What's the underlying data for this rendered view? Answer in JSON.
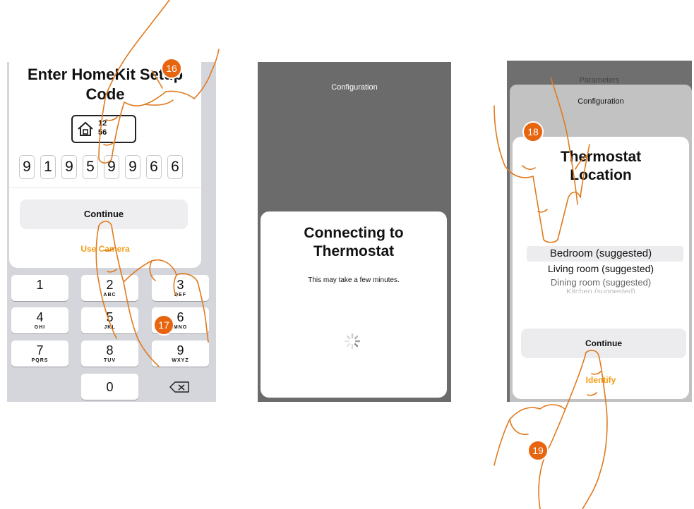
{
  "screen1": {
    "title": "Enter HomeKit Setup Code",
    "code_label_line1": "12",
    "code_label_line2": "56",
    "digits": [
      "9",
      "1",
      "9",
      "5",
      "9",
      "9",
      "6",
      "6"
    ],
    "continue_label": "Continue",
    "use_camera_label": "Use Camera",
    "keypad": [
      {
        "num": "1",
        "letters": ""
      },
      {
        "num": "2",
        "letters": "ABC"
      },
      {
        "num": "3",
        "letters": "DEF"
      },
      {
        "num": "4",
        "letters": "GHI"
      },
      {
        "num": "5",
        "letters": "JKL"
      },
      {
        "num": "6",
        "letters": "MNO"
      },
      {
        "num": "7",
        "letters": "PQRS"
      },
      {
        "num": "8",
        "letters": "TUV"
      },
      {
        "num": "9",
        "letters": "WXYZ"
      },
      {
        "num": "0",
        "letters": ""
      }
    ]
  },
  "screen2": {
    "header": "Configuration",
    "title": "Connecting to Thermostat",
    "subtitle": "This may take a few minutes."
  },
  "screen3": {
    "back_title": "Parameters",
    "header": "Configuration",
    "title": "Thermostat Location",
    "options": [
      "Bedroom (suggested)",
      "Living room (suggested)",
      "Dining room (suggested)",
      "Kitchen (suggested)"
    ],
    "continue_label": "Continue",
    "identify_label": "Identify"
  },
  "steps": [
    "16",
    "17",
    "18",
    "19"
  ],
  "colors": {
    "accent": "#e8650f",
    "link": "#f39c12",
    "hand_outline": "#e07a1f"
  },
  "icons": {
    "home": "home-icon",
    "backspace": "backspace-icon",
    "spinner": "spinner-icon"
  }
}
